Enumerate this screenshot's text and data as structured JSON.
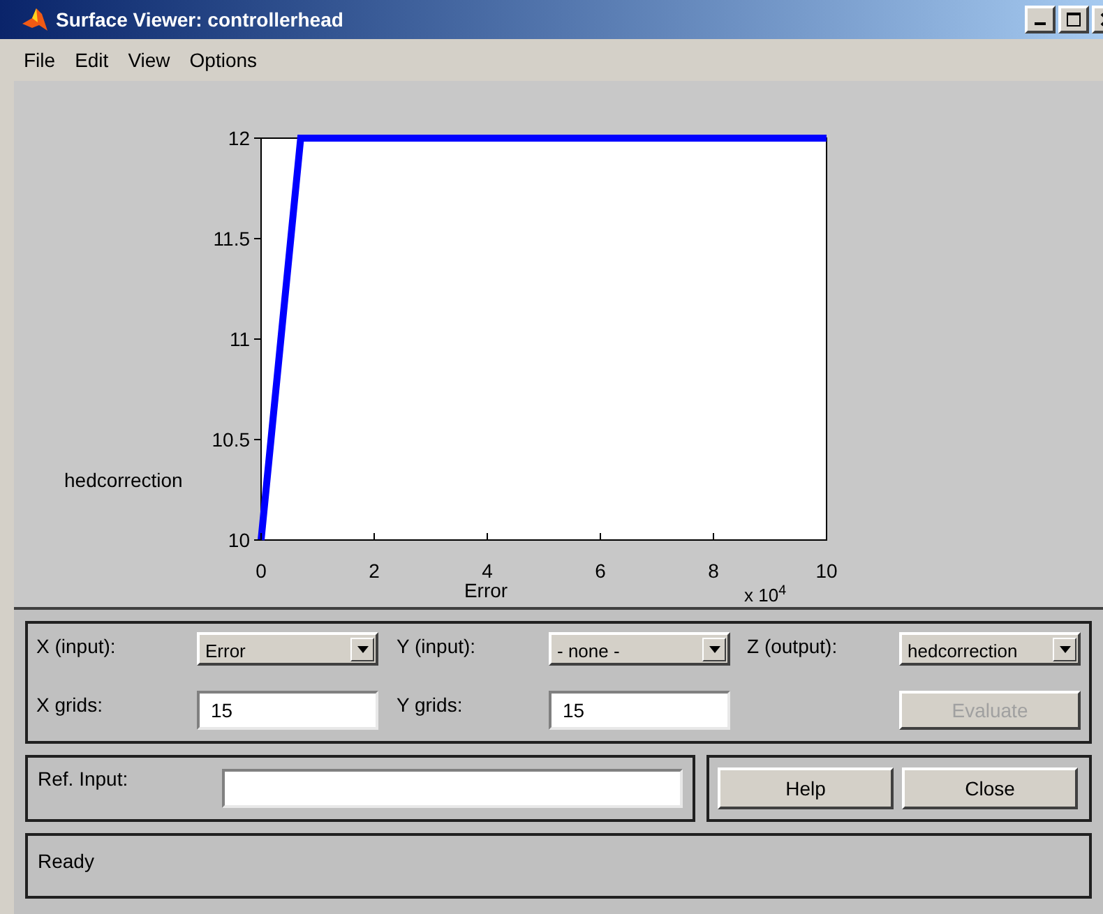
{
  "window": {
    "title": "Surface Viewer: controllerhead"
  },
  "menu": [
    "File",
    "Edit",
    "View",
    "Options"
  ],
  "plot": {
    "x_multiplier": "x 10$^{4}$",
    "chart_data": {
      "type": "line",
      "xlabel": "Error",
      "ylabel": "hedcorrection",
      "x": [
        0,
        0.7,
        10
      ],
      "series": [
        {
          "color": "#0000ff",
          "values": [
            10,
            12,
            12
          ]
        }
      ],
      "xlim": [
        0,
        10
      ],
      "ylim": [
        10,
        12
      ],
      "xticks": [
        0,
        2,
        4,
        6,
        8,
        10
      ],
      "yticks": [
        10,
        10.5,
        11,
        11.5,
        12
      ]
    }
  },
  "controls": {
    "x_input": {
      "label": "X (input):",
      "value": "Error"
    },
    "y_input": {
      "label": "Y (input):",
      "value": "- none -"
    },
    "z_output": {
      "label": "Z (output):",
      "value": "hedcorrection"
    },
    "x_grids": {
      "label": "X grids:",
      "value": "15"
    },
    "y_grids": {
      "label": "Y grids:",
      "value": "15"
    },
    "evaluate": {
      "label": "Evaluate",
      "disabled": true
    }
  },
  "ref_input": {
    "label": "Ref. Input:"
  },
  "buttons": [
    "Help",
    "Close"
  ],
  "status": "Ready"
}
